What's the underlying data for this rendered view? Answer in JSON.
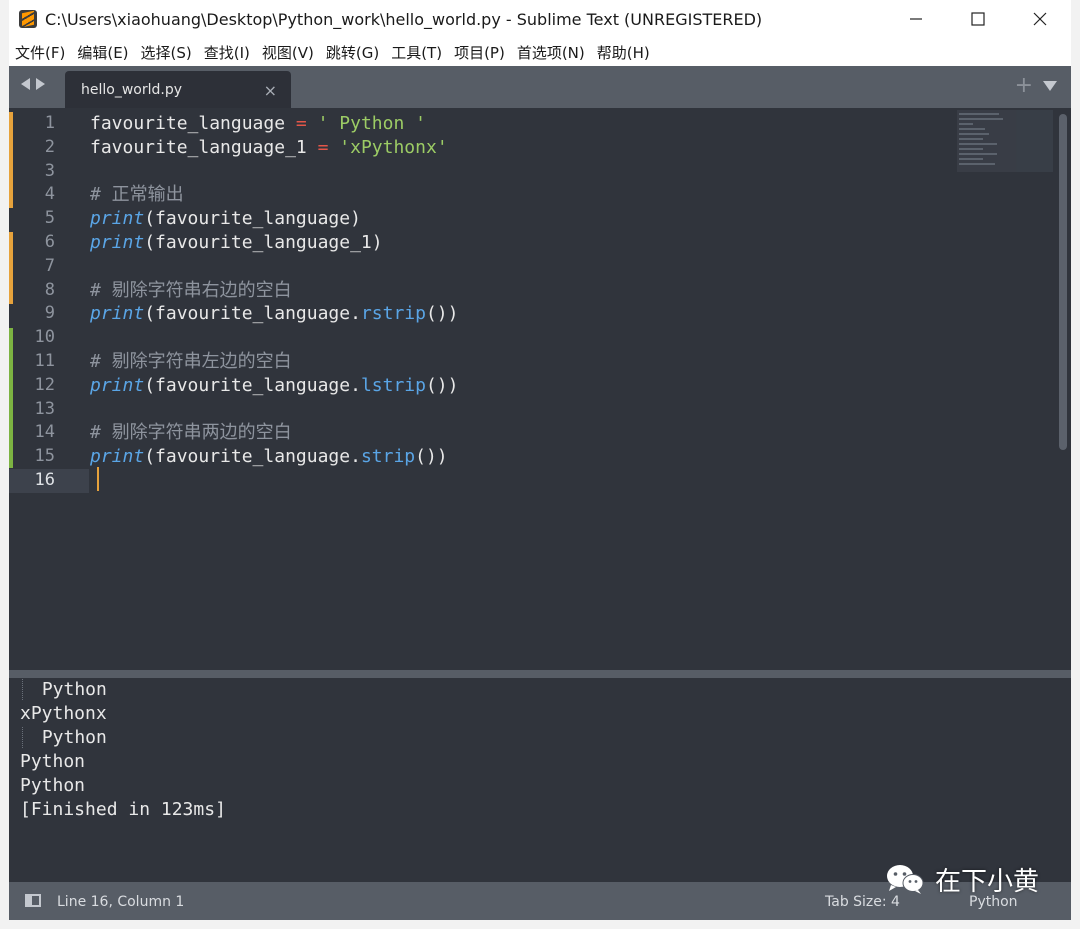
{
  "window": {
    "title": "C:\\Users\\xiaohuang\\Desktop\\Python_work\\hello_world.py - Sublime Text (UNREGISTERED)"
  },
  "menu": [
    "文件(F)",
    "编辑(E)",
    "选择(S)",
    "查找(I)",
    "视图(V)",
    "跳转(G)",
    "工具(T)",
    "项目(P)",
    "首选项(N)",
    "帮助(H)"
  ],
  "tab": {
    "filename": "hello_world.py",
    "close": "×",
    "new_tab": "+"
  },
  "editor": {
    "line_numbers": [
      "1",
      "2",
      "3",
      "4",
      "5",
      "6",
      "7",
      "8",
      "9",
      "10",
      "11",
      "12",
      "13",
      "14",
      "15",
      "16"
    ],
    "current_line": 16,
    "code": {
      "l1_var": "favourite_language",
      "l1_op": "=",
      "l1_str": "' Python '",
      "l2_var": "favourite_language_1",
      "l2_op": "=",
      "l2_str": "'xPythonx'",
      "l4_comment": "# 正常输出",
      "print_kw": "print",
      "l5_args": "(favourite_language)",
      "l6_args": "(favourite_language_1)",
      "l8_comment": "# 剔除字符串右边的空白",
      "arg_var": "(favourite_language.",
      "rstrip": "rstrip",
      "lstrip": "lstrip",
      "strip": "strip",
      "close_call": "())",
      "l11_comment": "# 剔除字符串左边的空白",
      "l14_comment": "# 剔除字符串两边的空白"
    }
  },
  "output": {
    "lines": [
      " Python",
      "xPythonx",
      " Python",
      "Python",
      "Python",
      "[Finished in 123ms]"
    ]
  },
  "statusbar": {
    "position": "Line 16, Column 1",
    "tab_size": "Tab Size: 4",
    "syntax": "Python"
  },
  "watermark": {
    "text": "在下小黄"
  },
  "colors": {
    "editor_bg": "#30343c",
    "chrome_bg": "#575d66",
    "string": "#9ccc65",
    "operator": "#e45649",
    "function": "#5aa5e6",
    "comment": "#8e949e",
    "cursor": "#e6a23c"
  }
}
